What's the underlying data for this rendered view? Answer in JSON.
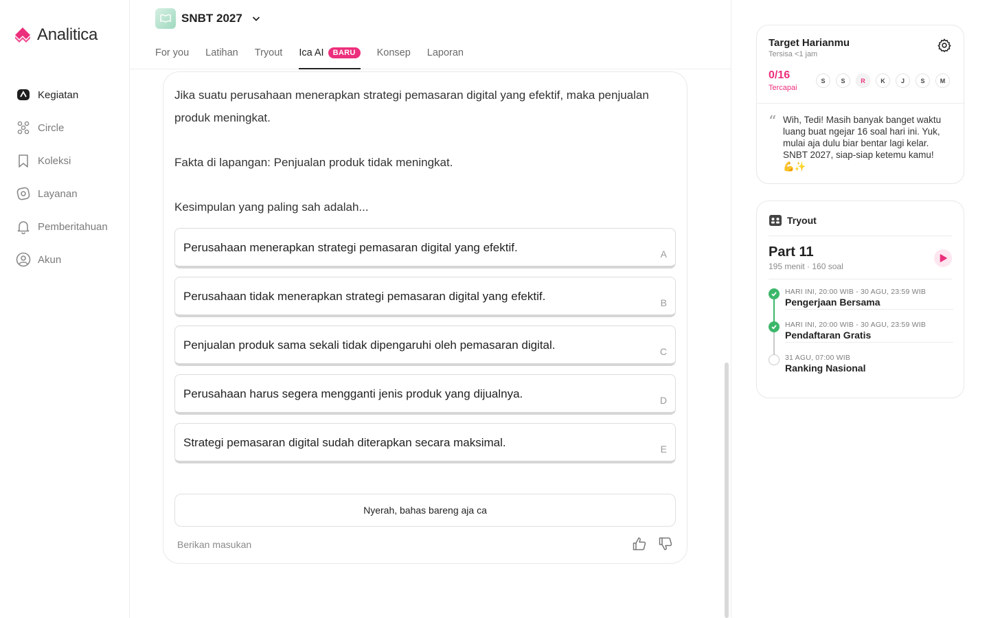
{
  "brand": {
    "name": "Analitica",
    "accent": "#ec2f7c"
  },
  "sidebar": {
    "items": [
      {
        "label": "Kegiatan",
        "icon": "activity-icon",
        "active": true
      },
      {
        "label": "Circle",
        "icon": "circle-group-icon",
        "active": false
      },
      {
        "label": "Koleksi",
        "icon": "bookmark-icon",
        "active": false
      },
      {
        "label": "Layanan",
        "icon": "service-icon",
        "active": false
      },
      {
        "label": "Pemberitahuan",
        "icon": "bell-icon",
        "active": false
      },
      {
        "label": "Akun",
        "icon": "user-icon",
        "active": false
      }
    ]
  },
  "header": {
    "program": "SNBT 2027",
    "tabs": [
      {
        "label": "For you"
      },
      {
        "label": "Latihan"
      },
      {
        "label": "Tryout"
      },
      {
        "label": "Ica AI",
        "badge": "BARU",
        "active": true
      },
      {
        "label": "Konsep"
      },
      {
        "label": "Laporan"
      }
    ]
  },
  "question": {
    "premise": "Jika suatu perusahaan menerapkan strategi pemasaran digital yang efektif, maka penjualan produk meningkat.",
    "fact": "Fakta di lapangan: Penjualan produk tidak meningkat.",
    "prompt": "Kesimpulan yang paling sah adalah...",
    "options": [
      {
        "text": "Perusahaan menerapkan strategi pemasaran digital yang efektif.",
        "letter": "A"
      },
      {
        "text": "Perusahaan tidak menerapkan strategi pemasaran digital yang efektif.",
        "letter": "B"
      },
      {
        "text": "Penjualan produk sama sekali tidak dipengaruhi oleh pemasaran digital.",
        "letter": "C"
      },
      {
        "text": "Perusahaan harus segera mengganti jenis produk yang dijualnya.",
        "letter": "D"
      },
      {
        "text": "Strategi pemasaran digital sudah diterapkan secara maksimal.",
        "letter": "E"
      }
    ],
    "give_up": "Nyerah, bahas bareng aja ca",
    "feedback": "Berikan masukan"
  },
  "target": {
    "title": "Target Harianmu",
    "subtitle": "Tersisa <1 jam",
    "score": "0/16",
    "score_label": "Tercapai",
    "days": [
      "S",
      "S",
      "R",
      "K",
      "J",
      "S",
      "M"
    ],
    "today_index": 2,
    "quote": "Wih, Tedi! Masih banyak banget waktu luang buat ngejar 16 soal hari ini. Yuk, mulai aja dulu biar bentar lagi kelar. SNBT 2027, siap-siap ketemu kamu! 💪✨"
  },
  "tryout": {
    "title": "Tryout",
    "part": "Part 11",
    "meta": "195 menit · 160 soal",
    "timeline": [
      {
        "date": "HARI INI, 20:00 WIB - 30 AGU, 23:59 WIB",
        "name": "Pengerjaan Bersama",
        "done": true
      },
      {
        "date": "HARI INI, 20:00 WIB - 30 AGU, 23:59 WIB",
        "name": "Pendaftaran Gratis",
        "done": true
      },
      {
        "date": "31 AGU, 07:00 WIB",
        "name": "Ranking Nasional",
        "done": false
      }
    ]
  }
}
